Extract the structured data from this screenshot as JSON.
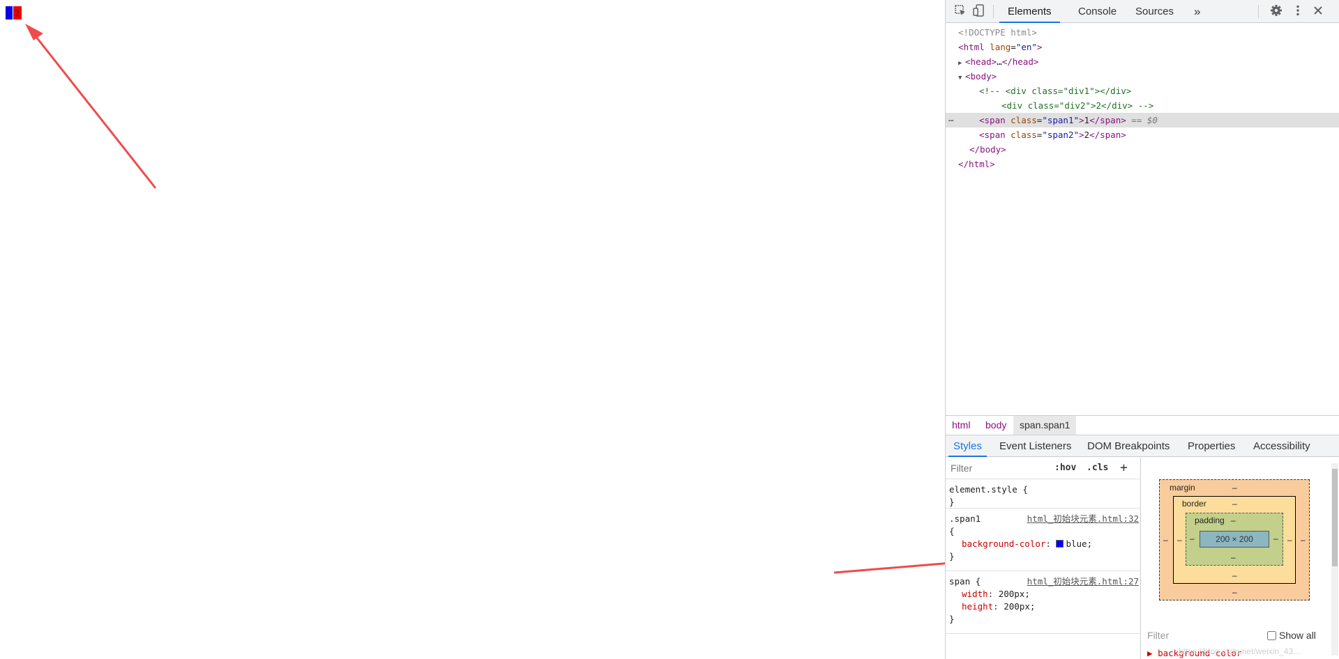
{
  "viewport": {
    "span1_text": "1",
    "span2_text": "2",
    "span1_color": "#0000ee",
    "span2_color": "#ee0000",
    "annotation_color": "#f04a4a"
  },
  "devtools": {
    "toolbar": {
      "inspect_icon": "inspect-icon",
      "device_icon": "device-toolbar-icon",
      "tabs": [
        "Elements",
        "Console",
        "Sources"
      ],
      "more_tabs": "»",
      "settings_icon": "gear-icon",
      "menu_icon": "kebab-icon",
      "close_icon": "close-icon"
    },
    "dom": {
      "doctype": "<!DOCTYPE html>",
      "html_open_tag": "html",
      "html_attr": "lang",
      "html_attr_val": "\"en\"",
      "head_collapsed": "…",
      "comment_line1_pre": "<!-- ",
      "div1_class": "\"div1\"",
      "div2_class": "\"div2\"",
      "div2_text": "2",
      "comment_end": " -->",
      "span1_class": "\"span1\"",
      "span1_text": "1",
      "span2_class": "\"span2\"",
      "span2_text": "2",
      "selected_marker": "== $0",
      "ellipsis": "⋯"
    },
    "breadcrumbs": [
      "html",
      "body",
      "span.span1"
    ],
    "subtabs": [
      "Styles",
      "Event Listeners",
      "DOM Breakpoints",
      "Properties",
      "Accessibility"
    ],
    "styles": {
      "filter_placeholder": "Filter",
      "hov": ":hov",
      "cls": ".cls",
      "add": "+",
      "element_style": "element.style {",
      "close_brace": "}",
      "rule1_selector": ".span1",
      "rule1_source": "html_初始块元素.html:32",
      "rule1_open": "{",
      "rule1_prop": "background-color",
      "rule1_value": "blue;",
      "rule1_swatch": "#0000ff",
      "rule2_selector": "span {",
      "rule2_source": "html_初始块元素.html:27",
      "rule2_prop1": "width",
      "rule2_val1": "200px;",
      "rule2_prop2": "height",
      "rule2_val2": "200px;"
    },
    "box_model": {
      "margin_label": "margin",
      "border_label": "border",
      "padding_label": "padding",
      "dash": "–",
      "content": "200 × 200",
      "filter_placeholder": "Filter",
      "show_all": "Show all",
      "computed_first": "background-color"
    }
  },
  "watermark": "https://blog.csdn.net/weixin_43…"
}
